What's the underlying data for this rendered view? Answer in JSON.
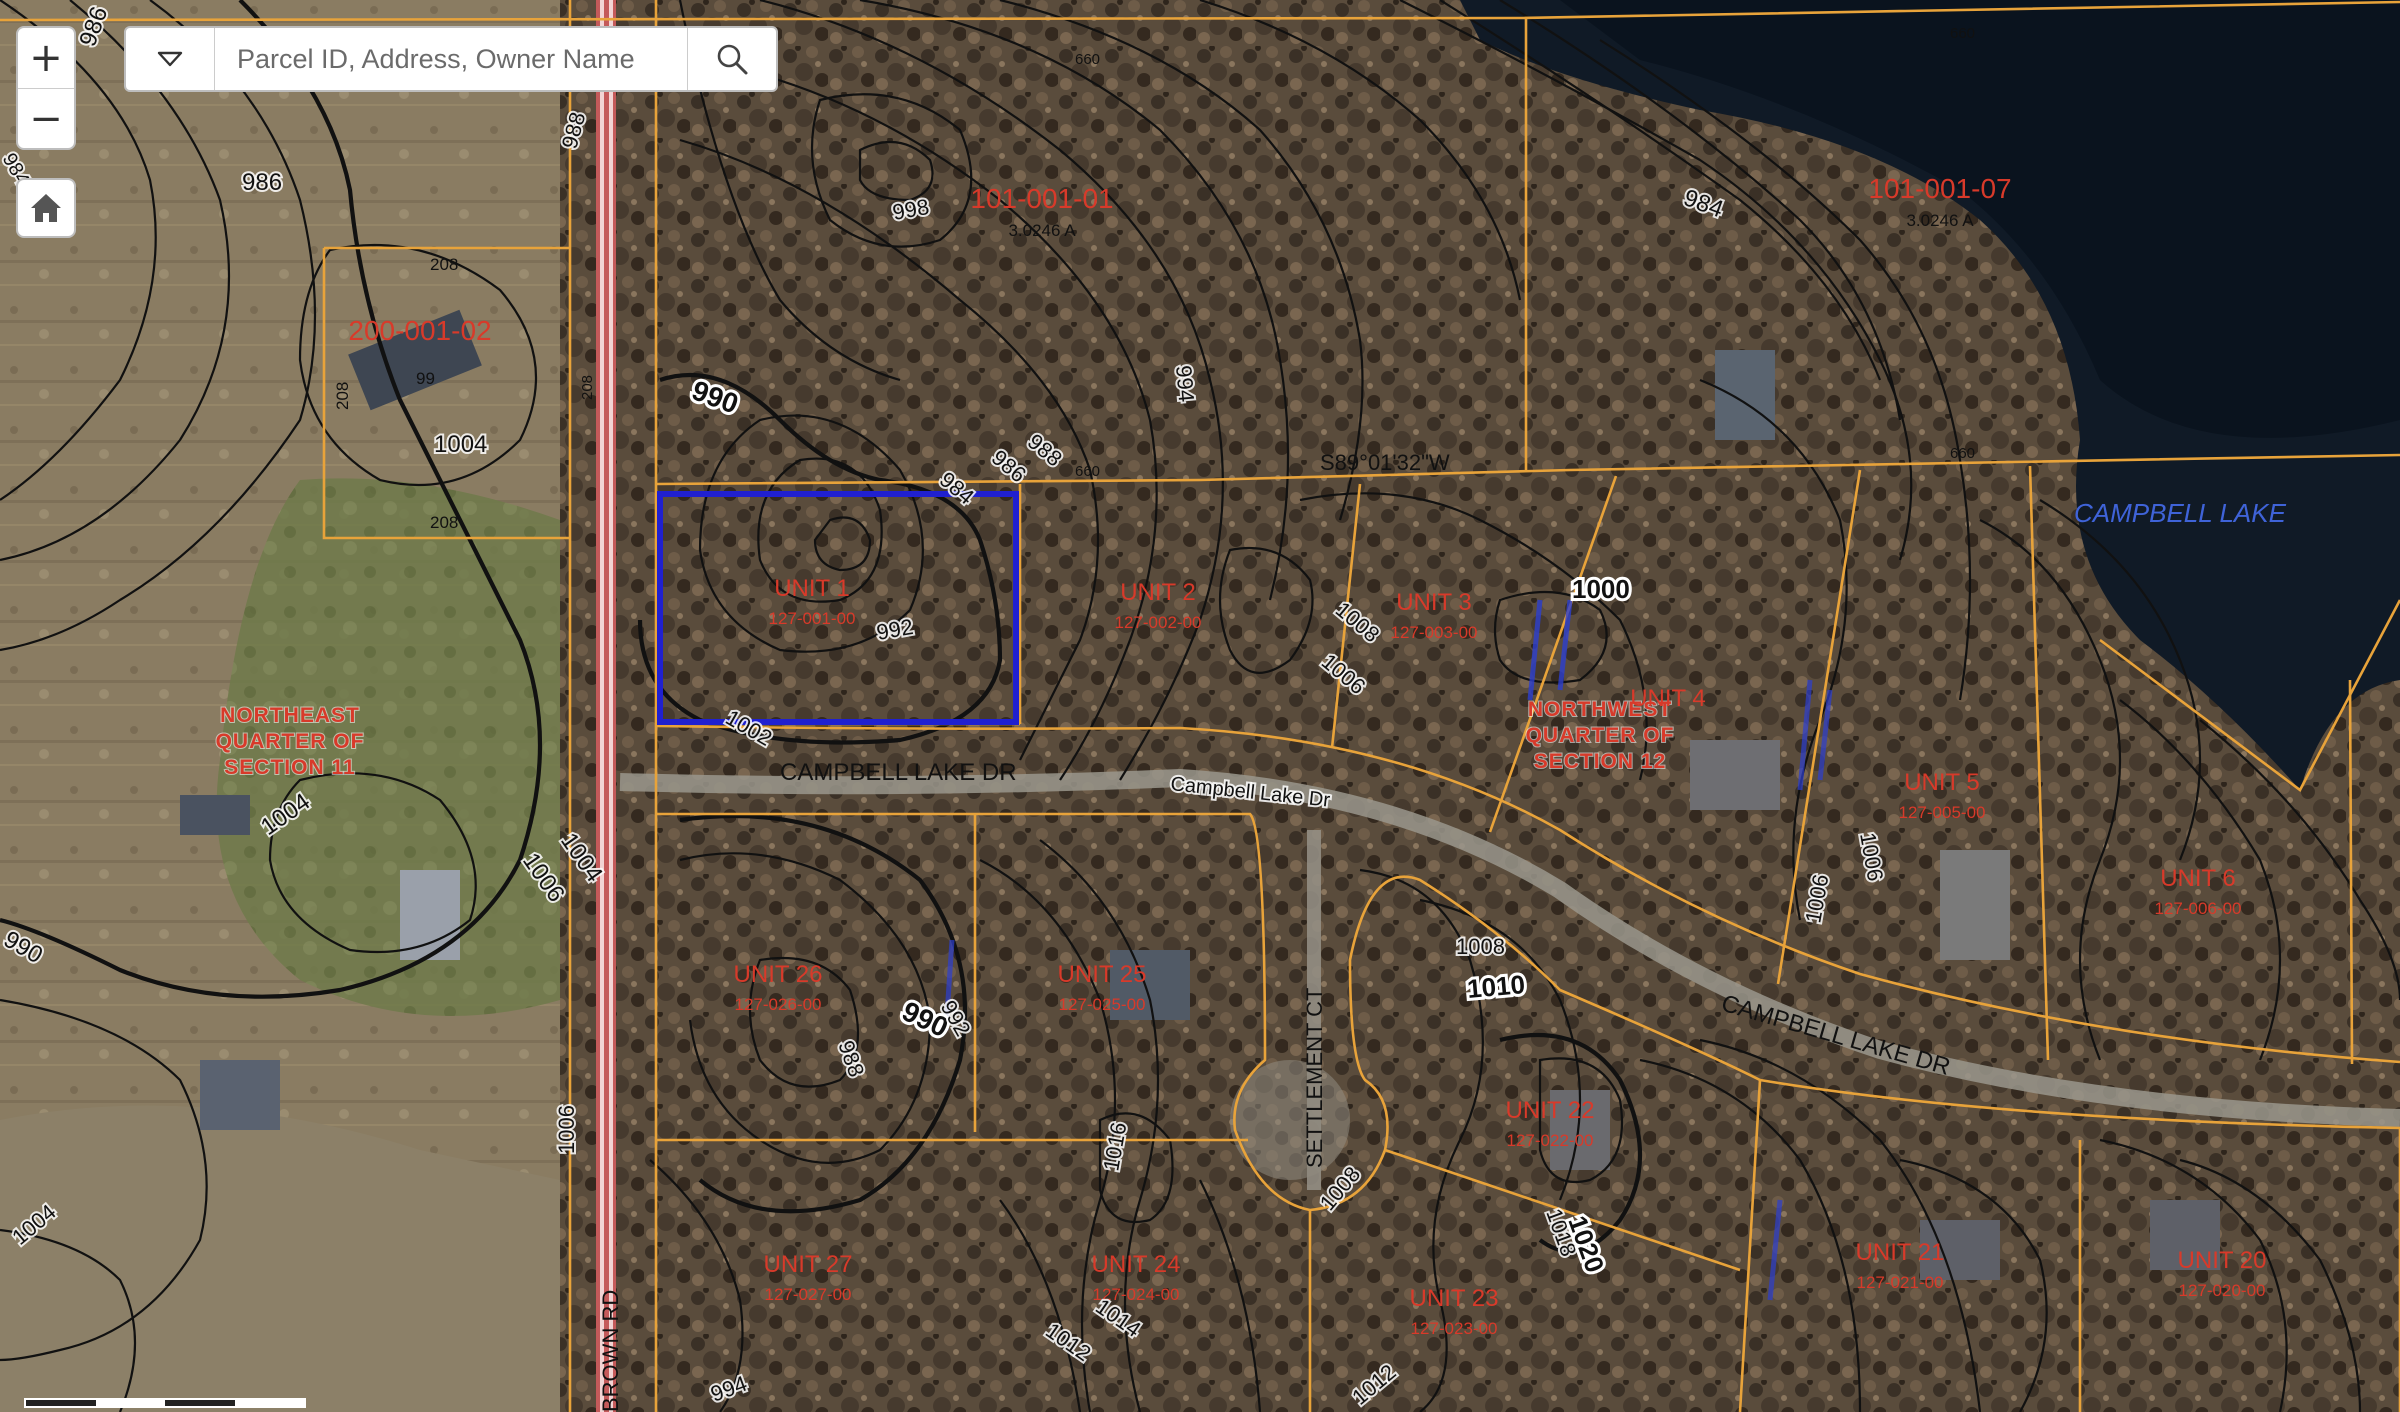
{
  "search": {
    "placeholder": "Parcel ID, Address, Owner Name",
    "dropdown_icon": "chevron-down-icon",
    "search_icon": "search-icon"
  },
  "controls": {
    "zoom_in": "+",
    "zoom_out": "−",
    "home_icon": "home-icon"
  },
  "colors": {
    "parcel_line": "#e8a33a",
    "contour_line": "#111111",
    "parcel_label": "#d83a2a",
    "selected_parcel": "#2020d0",
    "water_label": "#3f63d8",
    "road": "#c45a5a"
  },
  "map": {
    "water_label": "CAMPBELL LAKE",
    "road_labels": {
      "campbell_lake_dr_1": "CAMPBELL LAKE DR",
      "campbell_lake_dr_2": "CAMPBELL LAKE DR",
      "campbell_lake_dr_street": "Campbell Lake Dr",
      "settlement_ct": "SETTLEMENT CT",
      "brown_rd": "BROWN RD"
    },
    "bearing": "S89°01'32\"W",
    "sections": {
      "ne_section_11": [
        "NORTHEAST",
        "QUARTER OF",
        "SECTION 11"
      ],
      "nw_section_12": [
        "NORTHWEST",
        "QUARTER OF",
        "SECTION 12"
      ]
    },
    "parcels": [
      {
        "id": "p-200-001-02",
        "label": "200-001-02",
        "sub": ""
      },
      {
        "id": "p-101-001-01",
        "label": "101-001-01",
        "sub": "3.0246 A"
      },
      {
        "id": "p-101-001-07",
        "label": "101-001-07",
        "sub": "3.0246 A"
      },
      {
        "id": "p-unit-1",
        "label": "UNIT 1",
        "sub": "127-001-00"
      },
      {
        "id": "p-unit-2",
        "label": "UNIT 2",
        "sub": "127-002-00"
      },
      {
        "id": "p-unit-3",
        "label": "UNIT 3",
        "sub": "127-003-00"
      },
      {
        "id": "p-unit-4",
        "label": "UNIT 4",
        "sub": ""
      },
      {
        "id": "p-unit-5",
        "label": "UNIT 5",
        "sub": "127-005-00"
      },
      {
        "id": "p-unit-6",
        "label": "UNIT 6",
        "sub": "127-006-00"
      },
      {
        "id": "p-unit-26",
        "label": "UNIT 26",
        "sub": "127-026-00"
      },
      {
        "id": "p-unit-25",
        "label": "UNIT 25",
        "sub": "127-025-00"
      },
      {
        "id": "p-unit-22",
        "label": "UNIT 22",
        "sub": "127-022-00"
      },
      {
        "id": "p-unit-27",
        "label": "UNIT 27",
        "sub": "127-027-00"
      },
      {
        "id": "p-unit-24",
        "label": "UNIT 24",
        "sub": "127-024-00"
      },
      {
        "id": "p-unit-23",
        "label": "UNIT 23",
        "sub": "127-023-00"
      },
      {
        "id": "p-unit-21",
        "label": "UNIT 21",
        "sub": "127-021-00"
      },
      {
        "id": "p-unit-20",
        "label": "UNIT 20",
        "sub": "127-020-00"
      }
    ],
    "dimensions": {
      "d660_a": "660",
      "d660_b": "660",
      "d660_c": "660",
      "d660_d": "660",
      "d208_a": "208",
      "d208_b": "208",
      "d208_c": "208",
      "d208_d": "208",
      "d99": "99"
    },
    "contour_labels": {
      "c986_tl": "986",
      "c986_l": "986",
      "c988_top": "988",
      "c998": "998",
      "c990_big": "990",
      "c986_mid": "986",
      "c988_mid": "988",
      "c984_unit1": "984",
      "c992_unit1": "992",
      "c1002": "1002",
      "c994_top": "994",
      "c984_right": "984",
      "c1004_l": "1004",
      "c1004_a": "1004",
      "c1006_a": "1006",
      "c1004_b": "1004",
      "c1008_u3": "1008",
      "c1006_u3": "1006",
      "c1000_big": "1000",
      "c1006_u5": "1006",
      "c1006_u5b": "1006",
      "c1008_mid": "1008",
      "c1010_big": "1010",
      "c990_u26": "990",
      "c992_u26": "992",
      "c988_u26": "988",
      "c1016": "1016",
      "c1014": "1014",
      "c1012_a": "1012",
      "c1008_ct": "1008",
      "c1018": "1018",
      "c1020_big": "1020",
      "c994_bottom": "994",
      "c1012_b": "1012",
      "c1006_left": "1006",
      "c1004_bl": "1004",
      "c990_edge": "990",
      "c984_edge": "984"
    }
  }
}
